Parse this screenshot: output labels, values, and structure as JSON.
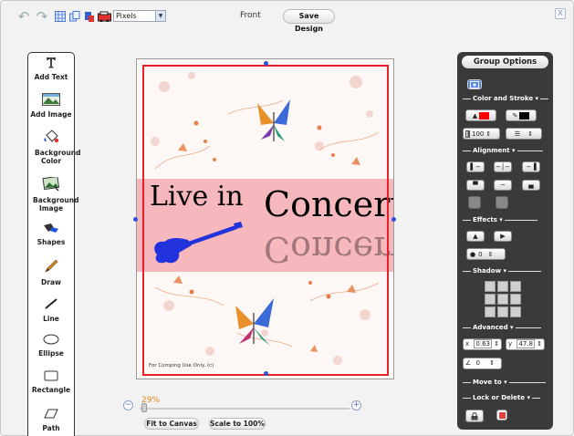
{
  "toolbar": {
    "units_value": "Pixels",
    "side_label": "Front",
    "save_label": "Save Design",
    "close_glyph": "X"
  },
  "tools": [
    {
      "label": "Add Text",
      "icon": "text-tool-icon"
    },
    {
      "label": "Add Image",
      "icon": "image-icon"
    },
    {
      "label": "Background Color",
      "icon": "paint-bucket-icon"
    },
    {
      "label": "Background Image",
      "icon": "background-image-icon"
    },
    {
      "label": "Shapes",
      "icon": "shapes-icon"
    },
    {
      "label": "Draw",
      "icon": "pencil-icon"
    },
    {
      "label": "Line",
      "icon": "line-icon"
    },
    {
      "label": "Ellipse",
      "icon": "ellipse-icon"
    },
    {
      "label": "Rectangle",
      "icon": "rectangle-icon"
    },
    {
      "label": "Path",
      "icon": "path-icon"
    }
  ],
  "design": {
    "text_live": "Live in",
    "text_concert": "Concert",
    "footer_text": "For Comping Use Only. (c)",
    "band_color": "#f7b8bd",
    "guitar_color": "#2233dd",
    "selection_color": "#e8202a"
  },
  "zoom": {
    "percent": "29%",
    "value": 0.29,
    "fit_label": "Fit to Canvas",
    "scale_label": "Scale to 100%"
  },
  "panel": {
    "title": "Group Options",
    "color_stroke": "Color and Stroke",
    "opacity_value": "100",
    "alignment": "Alignment",
    "effects": "Effects",
    "effect_value": "0",
    "shadow": "Shadow",
    "advanced": "Advanced",
    "x_label": "x",
    "x_value": "0.63",
    "y_label": "y",
    "y_value": "47.8",
    "angle_value": "0",
    "move_to": "Move to",
    "lock_delete": "Lock or Delete",
    "fill_color": "#ff0000",
    "stroke_color": "#000000"
  }
}
